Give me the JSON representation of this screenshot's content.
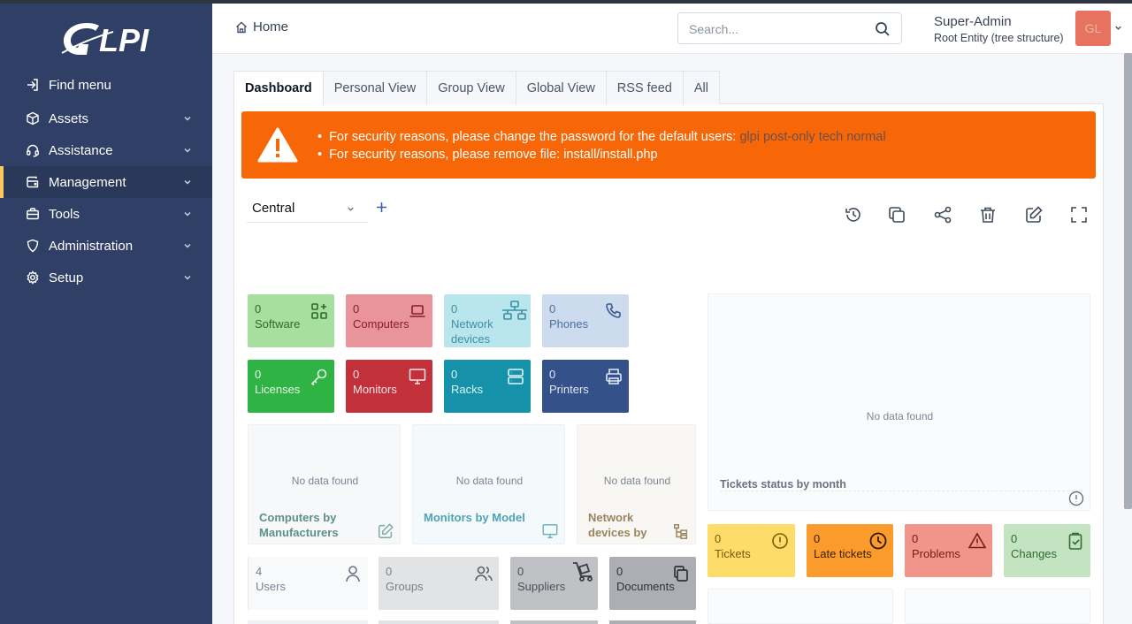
{
  "app": {
    "logo_text": "GLPI"
  },
  "sidebar": {
    "find_menu": "Find menu",
    "items": [
      {
        "label": "Assets",
        "icon": "cube-icon"
      },
      {
        "label": "Assistance",
        "icon": "headset-icon"
      },
      {
        "label": "Management",
        "icon": "wallet-icon",
        "active": true
      },
      {
        "label": "Tools",
        "icon": "briefcase-icon"
      },
      {
        "label": "Administration",
        "icon": "shield-icon"
      },
      {
        "label": "Setup",
        "icon": "gear-icon"
      }
    ]
  },
  "header": {
    "breadcrumb": "Home",
    "search_placeholder": "Search...",
    "user_name": "Super-Admin",
    "user_entity": "Root Entity (tree structure)",
    "avatar_initials": "GL"
  },
  "tabs": [
    "Dashboard",
    "Personal View",
    "Group View",
    "Global View",
    "RSS feed",
    "All"
  ],
  "alert": {
    "line1_prefix": "For security reasons, please change the password for the default users:",
    "line1_users": "glpi post-only tech normal",
    "line2": "For security reasons, please remove file: install/install.php"
  },
  "dashboard": {
    "selected": "Central",
    "cards": [
      {
        "count": "0",
        "label": "Software",
        "icon": "apps-plus-icon"
      },
      {
        "count": "0",
        "label": "Computers",
        "icon": "laptop-icon"
      },
      {
        "count": "0",
        "label": "Network devices",
        "label_line1": "Network",
        "label_line2": "devices",
        "icon": "network-icon"
      },
      {
        "count": "0",
        "label": "Phones",
        "icon": "phone-icon"
      },
      {
        "count": "0",
        "label": "Licenses",
        "icon": "key-icon"
      },
      {
        "count": "0",
        "label": "Monitors",
        "icon": "monitor-icon"
      },
      {
        "count": "0",
        "label": "Racks",
        "icon": "server-icon"
      },
      {
        "count": "0",
        "label": "Printers",
        "icon": "printer-icon"
      }
    ],
    "widgets": [
      {
        "title_line1": "Computers by",
        "title_line2": "Manufacturers",
        "empty": "No data found"
      },
      {
        "title_line1": "Monitors by Model",
        "title_line2": "",
        "empty": "No data found"
      },
      {
        "title_line1": "Network",
        "title_line2": "devices by",
        "empty": "No data found"
      }
    ],
    "tickets_chart": {
      "title": "Tickets status by month",
      "empty": "No data found"
    },
    "ticket_cards": [
      {
        "count": "0",
        "label": "Tickets",
        "icon": "alert-circle-icon"
      },
      {
        "count": "0",
        "label": "Late tickets",
        "icon": "clock-icon"
      },
      {
        "count": "0",
        "label": "Problems",
        "icon": "warning-triangle-icon"
      },
      {
        "count": "0",
        "label": "Changes",
        "icon": "clipboard-check-icon"
      }
    ],
    "people_cards": [
      {
        "count": "4",
        "label": "Users",
        "icon": "user-icon"
      },
      {
        "count": "0",
        "label": "Groups",
        "icon": "users-icon"
      },
      {
        "count": "0",
        "label": "Suppliers",
        "icon": "dolly-icon"
      },
      {
        "count": "0",
        "label": "Documents",
        "icon": "copy-icon"
      }
    ]
  }
}
